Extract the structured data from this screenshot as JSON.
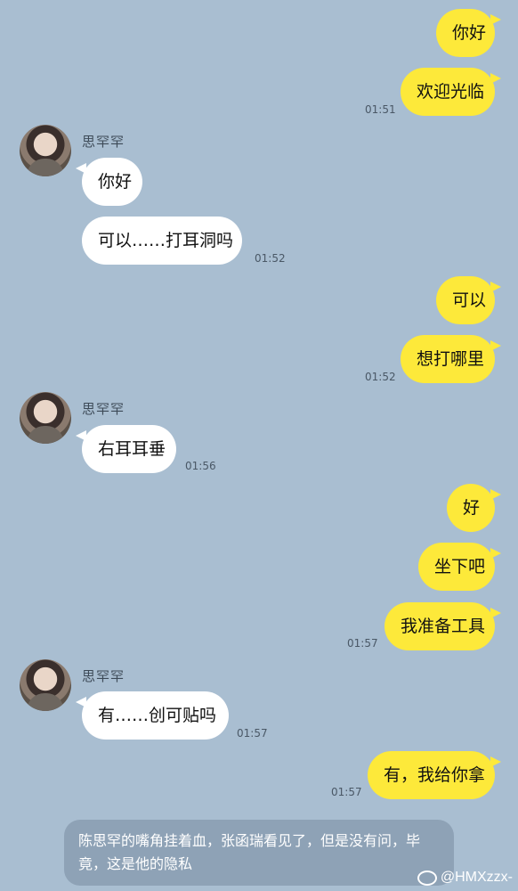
{
  "messages": [
    {
      "text": "你好"
    },
    {
      "text": "欢迎光临"
    },
    {
      "text": "你好"
    },
    {
      "text": "可以……打耳洞吗"
    },
    {
      "text": "可以"
    },
    {
      "text": "想打哪里"
    },
    {
      "text": "右耳耳垂"
    },
    {
      "text": "好"
    },
    {
      "text": "坐下吧"
    },
    {
      "text": "我准备工具"
    },
    {
      "text": "有……创可贴吗"
    },
    {
      "text": "有，我给你拿"
    }
  ],
  "times": [
    "01:51",
    "01:52",
    "01:52",
    "01:56",
    "01:57",
    "01:57",
    "01:57"
  ],
  "contact_name": "思罕罕",
  "narration": "陈思罕的嘴角挂着血，张函瑞看见了，但是没有问，毕竟，这是他的隐私",
  "watermark": "@HMXzzx-",
  "colors": {
    "background": "#a9bed1",
    "my_bubble": "#fde93a",
    "other_bubble": "#ffffff"
  }
}
